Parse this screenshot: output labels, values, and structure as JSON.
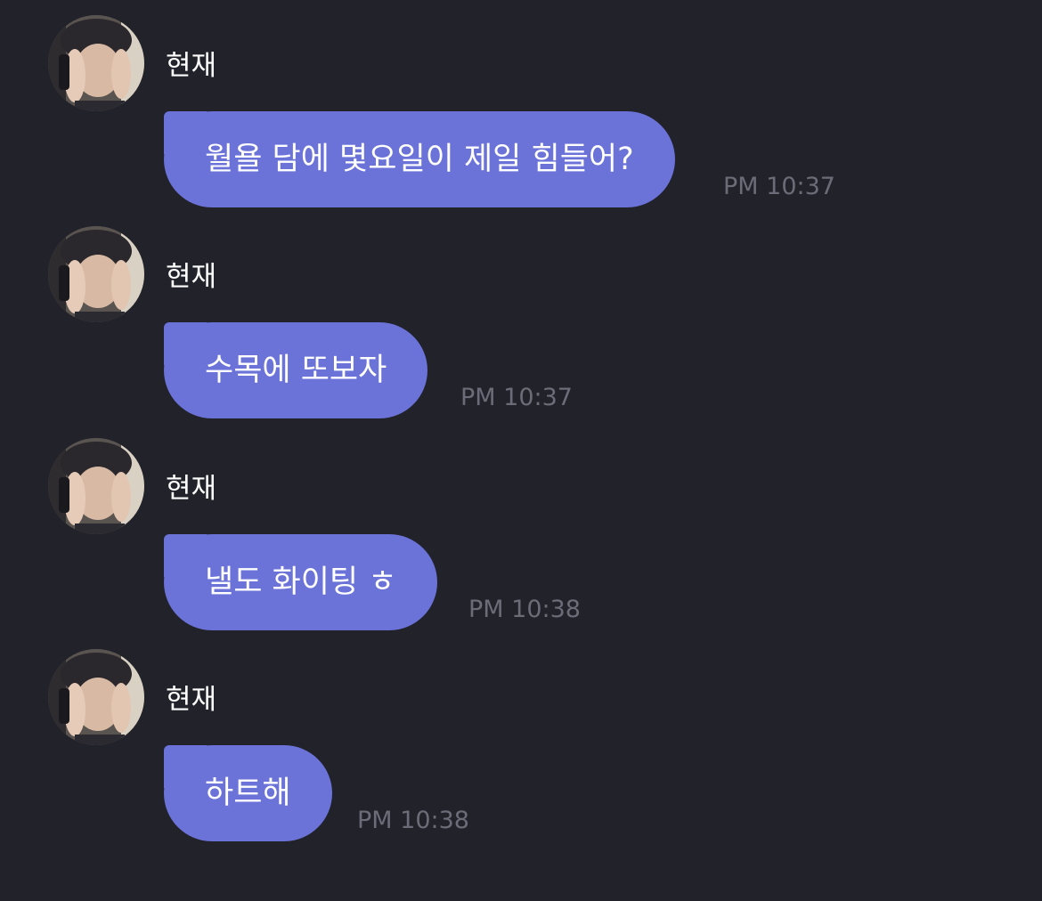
{
  "messages": [
    {
      "sender": "현재",
      "text": "월욜 담에 몇요일이 제일 힘들어?",
      "time": "PM 10:37"
    },
    {
      "sender": "현재",
      "text": "수목에 또보자",
      "time": "PM 10:37"
    },
    {
      "sender": "현재",
      "text": "낼도 화이팅 ㅎ",
      "time": "PM 10:38"
    },
    {
      "sender": "현재",
      "text": "하트해",
      "time": "PM 10:38"
    }
  ],
  "colors": {
    "background": "#22222a",
    "bubble": "#6b72d8",
    "bubble_text": "#ffffff",
    "sender_text": "#ffffff",
    "time_text": "#6c6c78"
  }
}
